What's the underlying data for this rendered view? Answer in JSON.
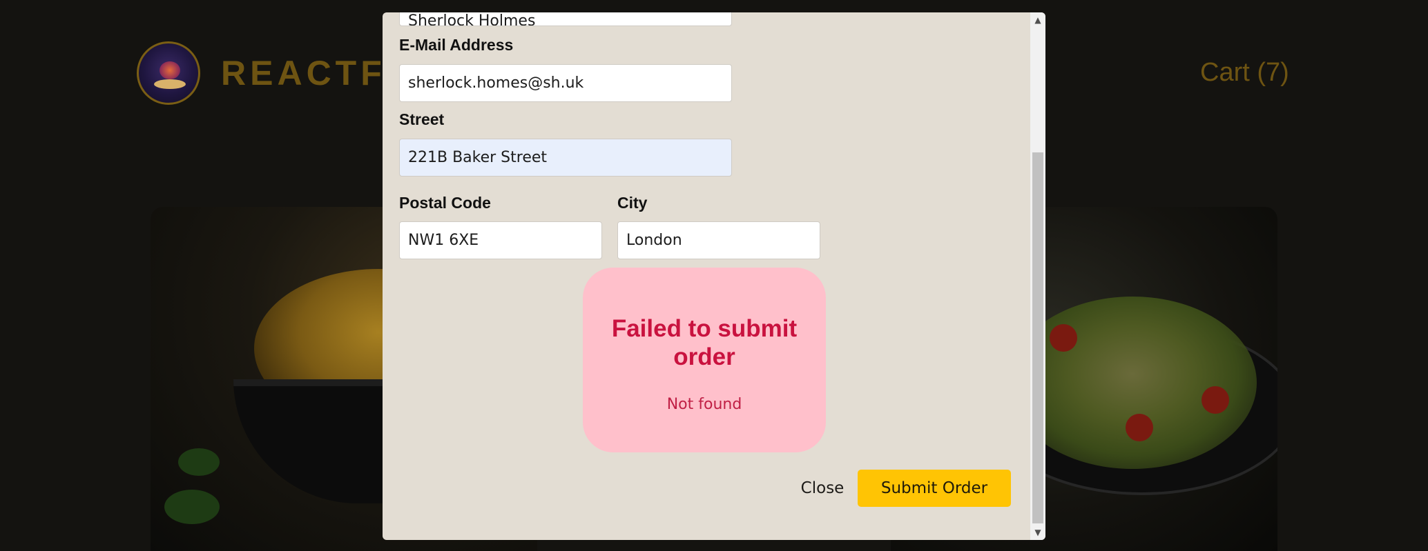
{
  "header": {
    "brand": "REACTFO",
    "cart_label": "Cart (7)"
  },
  "checkout_form": {
    "full_name_value": "Sherlock Holmes",
    "email": {
      "label": "E-Mail Address",
      "value": "sherlock.homes@sh.uk"
    },
    "street": {
      "label": "Street",
      "value": "221B Baker Street"
    },
    "postal_code": {
      "label": "Postal Code",
      "value": "NW1 6XE"
    },
    "city": {
      "label": "City",
      "value": "London"
    }
  },
  "error": {
    "title": "Failed to submit order",
    "message": "Not found"
  },
  "actions": {
    "close_label": "Close",
    "submit_label": "Submit Order"
  },
  "scrollbar": {
    "up_icon": "▲",
    "down_icon": "▼"
  },
  "colors": {
    "modal_bg": "#e3ddd3",
    "error_bg": "#ffc0cb",
    "error_text": "#c9123f",
    "submit_bg": "#ffc404",
    "brand_gold": "#6e5412"
  }
}
